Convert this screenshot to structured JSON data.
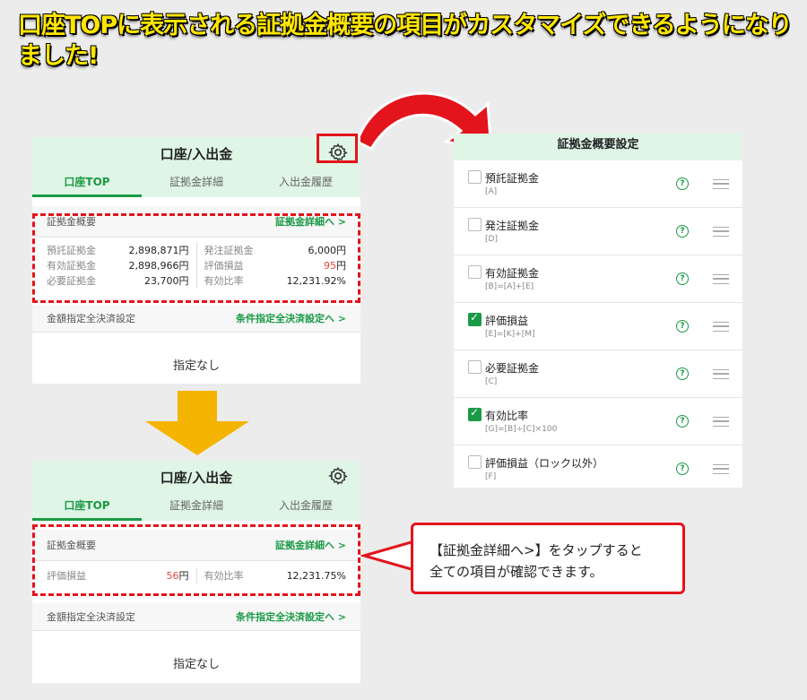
{
  "headline": "口座TOPに表示される証拠金概要の項目がカスタマイズできるようになりました!",
  "screen": {
    "title": "口座/入出金",
    "tabs": [
      "口座TOP",
      "証拠金詳細",
      "入出金履歴"
    ],
    "summary_label": "証拠金概要",
    "summary_link": "証拠金詳細へ >",
    "settle_label": "金額指定全決済設定",
    "settle_link": "条件指定全決済設定へ >",
    "none_text": "指定なし"
  },
  "before_rows": {
    "left": [
      {
        "label": "預託証拠金",
        "value": "2,898,871円"
      },
      {
        "label": "有効証拠金",
        "value": "2,898,966円"
      },
      {
        "label": "必要証拠金",
        "value": "23,700円"
      }
    ],
    "right": [
      {
        "label": "発注証拠金",
        "value": "6,000円"
      },
      {
        "label": "評価損益",
        "value_red": "95",
        "unit": "円"
      },
      {
        "label": "有効比率",
        "value": "12,231.92%"
      }
    ]
  },
  "after_rows": {
    "left": {
      "label": "評価損益",
      "value_red": "56",
      "unit": "円"
    },
    "right": {
      "label": "有効比率",
      "value": "12,231.75%"
    }
  },
  "settings": {
    "title": "証拠金概要設定",
    "items": [
      {
        "label": "預託証拠金",
        "sub": "[A]",
        "checked": false
      },
      {
        "label": "発注証拠金",
        "sub": "[D]",
        "checked": false
      },
      {
        "label": "有効証拠金",
        "sub": "[B]=[A]+[E]",
        "checked": false
      },
      {
        "label": "評価損益",
        "sub": "[E]=[K]+[M]",
        "checked": true
      },
      {
        "label": "必要証拠金",
        "sub": "[C]",
        "checked": false
      },
      {
        "label": "有効比率",
        "sub": "[G]=[B]÷[C]×100",
        "checked": true
      },
      {
        "label": "評価損益（ロック以外）",
        "sub": "[F]",
        "checked": false
      }
    ],
    "help_glyph": "?"
  },
  "callout": {
    "line1": "【証拠金詳細へ>】をタップすると",
    "line2": "全ての項目が確認できます。"
  },
  "colors": {
    "accent": "#1a9a45",
    "highlight": "#e3141b",
    "header_bg": "#dff5e6",
    "headline": "#ffe600",
    "arrow_gold": "#f5b400"
  }
}
